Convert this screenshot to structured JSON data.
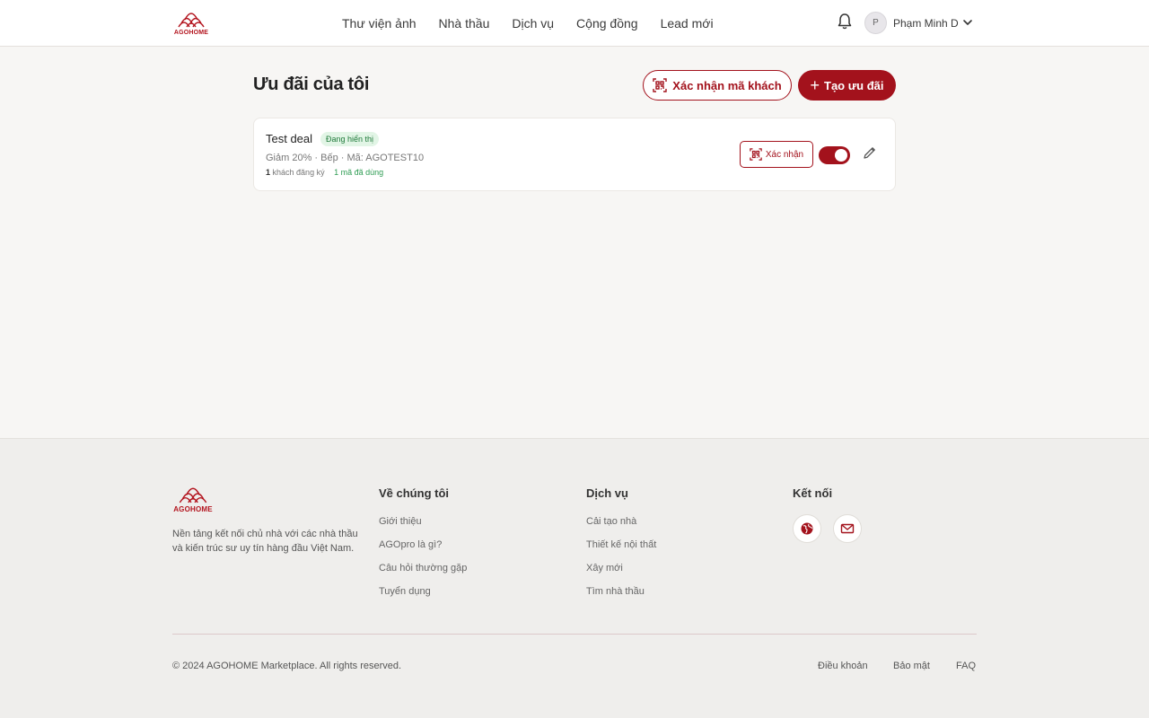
{
  "brand": {
    "name": "AGOHOME",
    "accent": "#a3121c"
  },
  "nav": {
    "items": [
      "Thư viện ảnh",
      "Nhà thầu",
      "Dịch vụ",
      "Cộng đồng",
      "Lead mới"
    ]
  },
  "user": {
    "initial": "P",
    "name": "Phạm Minh D"
  },
  "page": {
    "title": "Ưu đãi của tôi",
    "verify_button": "Xác nhận mã khách",
    "create_button": "Tạo ưu đãi"
  },
  "deals": [
    {
      "title": "Test deal",
      "status": "Đang hiển thị",
      "meta": "Giảm 20% · Bếp · Mã: AGOTEST10",
      "registered_count": "1",
      "registered_label": "khách đăng ký",
      "used_count": "1",
      "used_label": "mã đã dùng",
      "confirm_label": "Xác nhận",
      "active": true
    }
  ],
  "footer": {
    "description": "Nền tảng kết nối chủ nhà với các nhà thầu và kiến trúc sư uy tín hàng đầu Việt Nam.",
    "about": {
      "title": "Về chúng tôi",
      "links": [
        "Giới thiệu",
        "AGOpro là gì?",
        "Câu hỏi thường gặp",
        "Tuyển dụng"
      ]
    },
    "services": {
      "title": "Dịch vụ",
      "links": [
        "Cải tạo nhà",
        "Thiết kế nội thất",
        "Xây mới",
        "Tìm nhà thầu"
      ]
    },
    "connect": {
      "title": "Kết nối",
      "icons": [
        "globe-icon",
        "mail-icon"
      ]
    },
    "copyright": "© 2024 AGOHOME Marketplace. All rights reserved.",
    "legal": [
      "Điều khoản",
      "Bảo mật",
      "FAQ"
    ]
  }
}
